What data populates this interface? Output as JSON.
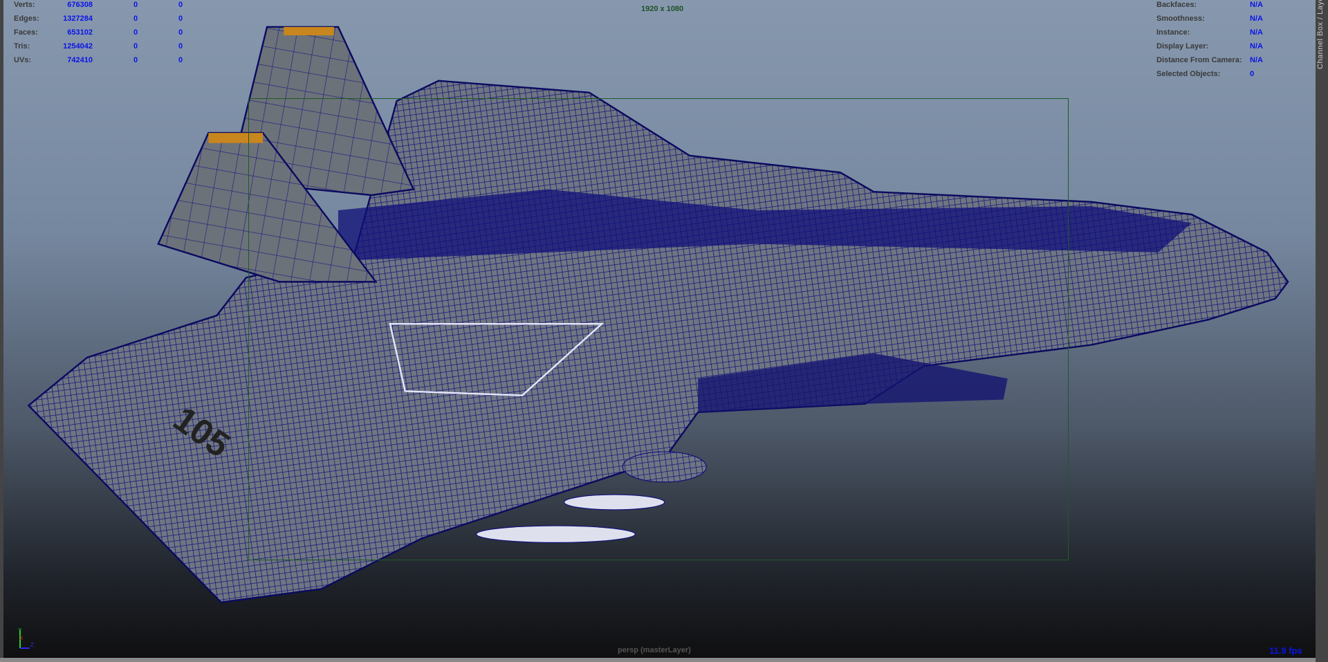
{
  "hud_left": {
    "rows": [
      {
        "label": "Verts:",
        "values": [
          "676308",
          "0",
          "0"
        ]
      },
      {
        "label": "Edges:",
        "values": [
          "1327284",
          "0",
          "0"
        ]
      },
      {
        "label": "Faces:",
        "values": [
          "653102",
          "0",
          "0"
        ]
      },
      {
        "label": "Tris:",
        "values": [
          "1254042",
          "0",
          "0"
        ]
      },
      {
        "label": "UVs:",
        "values": [
          "742410",
          "0",
          "0"
        ]
      }
    ]
  },
  "hud_right": {
    "rows": [
      {
        "label": "Backfaces:",
        "value": "N/A"
      },
      {
        "label": "Smoothness:",
        "value": "N/A"
      },
      {
        "label": "Instance:",
        "value": "N/A"
      },
      {
        "label": "Display Layer:",
        "value": "N/A"
      },
      {
        "label": "Distance From Camera:",
        "value": "N/A"
      },
      {
        "label": "Selected Objects:",
        "value": "0"
      }
    ]
  },
  "resolution": "1920 x 1080",
  "camera_label": "persp (masterLayer)",
  "fps": "11.9 fps",
  "channel_box_tab": "Channel Box / Layer",
  "axis": {
    "x": "X",
    "y": "Y",
    "z": "Z"
  },
  "colors": {
    "wireframe": "#10107a",
    "hud_value": "#0a14e6",
    "gate": "#1d5a24"
  }
}
